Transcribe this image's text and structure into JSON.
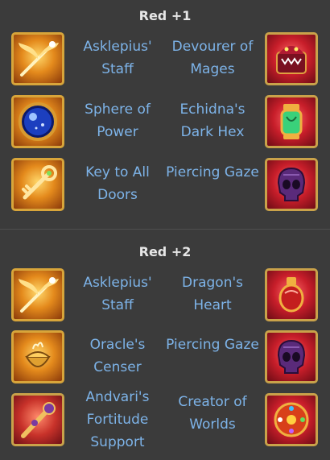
{
  "sections": [
    {
      "title": "Red +1",
      "rows": [
        {
          "left_label": "Asklepius' Staff",
          "right_label": "Devourer of Mages",
          "left_icon": "winged-staff-icon",
          "right_icon": "mage-mimic-icon"
        },
        {
          "left_label": "Sphere of Power",
          "right_label": "Echidna's Dark Hex",
          "left_icon": "blue-sphere-icon",
          "right_icon": "potion-vial-icon"
        },
        {
          "left_label": "Key to All Doors",
          "right_label": "Piercing Gaze",
          "left_icon": "golden-key-icon",
          "right_icon": "purple-skull-icon"
        }
      ]
    },
    {
      "title": "Red +2",
      "rows": [
        {
          "left_label": "Asklepius' Staff",
          "right_label": "Dragon's Heart",
          "left_icon": "winged-staff-icon",
          "right_icon": "dragon-heart-icon"
        },
        {
          "left_label": "Oracle's Censer",
          "right_label": "Piercing Gaze",
          "left_icon": "censer-icon",
          "right_icon": "purple-skull-icon"
        },
        {
          "left_label": "Andvari's Fortitude Support",
          "right_label": "Creator of Worlds",
          "left_icon": "ornate-scepter-icon",
          "right_icon": "gem-orb-icon"
        }
      ]
    }
  ]
}
